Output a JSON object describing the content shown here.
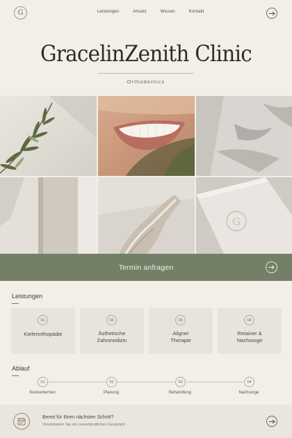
{
  "header": {
    "logo_letter": "G",
    "nav": [
      "Leistungen",
      "Ansatz",
      "Wissen",
      "Kontakt"
    ]
  },
  "hero": {
    "brand": "GracelinZenith Clinic",
    "subtitle": "Orthodontics"
  },
  "gallery": {
    "tiles": [
      "olive-branch-photo",
      "smile-photo",
      "linen-shadow-photo",
      "wall-shadow-photo",
      "stone-photo",
      "embossed-card-photo"
    ],
    "card_letter": "G"
  },
  "cta": {
    "label": "Termin anfragen"
  },
  "services": {
    "title": "Leistungen",
    "items": [
      {
        "num": "01",
        "line1": "Kieferorthopädie",
        "line2": ""
      },
      {
        "num": "02",
        "line1": "Ästhetische",
        "line2": "Zahnmedizin"
      },
      {
        "num": "03",
        "line1": "Aligner",
        "line2": "Therapie"
      },
      {
        "num": "04",
        "line1": "Retainer &",
        "line2": "Nachsorge"
      }
    ]
  },
  "process": {
    "title": "Ablauf",
    "steps": [
      {
        "num": "01",
        "label": "Kennenlernen"
      },
      {
        "num": "02",
        "label": "Planung"
      },
      {
        "num": "03",
        "label": "Behandlung"
      },
      {
        "num": "04",
        "label": "Nachsorge"
      }
    ]
  },
  "footer": {
    "title": "Bereit für Ihren nächsten Schritt?",
    "subtitle": "Vereinbaren Sie ein unverbindliches Gespräch"
  },
  "colors": {
    "background": "#f3efe8",
    "accent_green": "#737f66",
    "card": "#e9e4db"
  }
}
